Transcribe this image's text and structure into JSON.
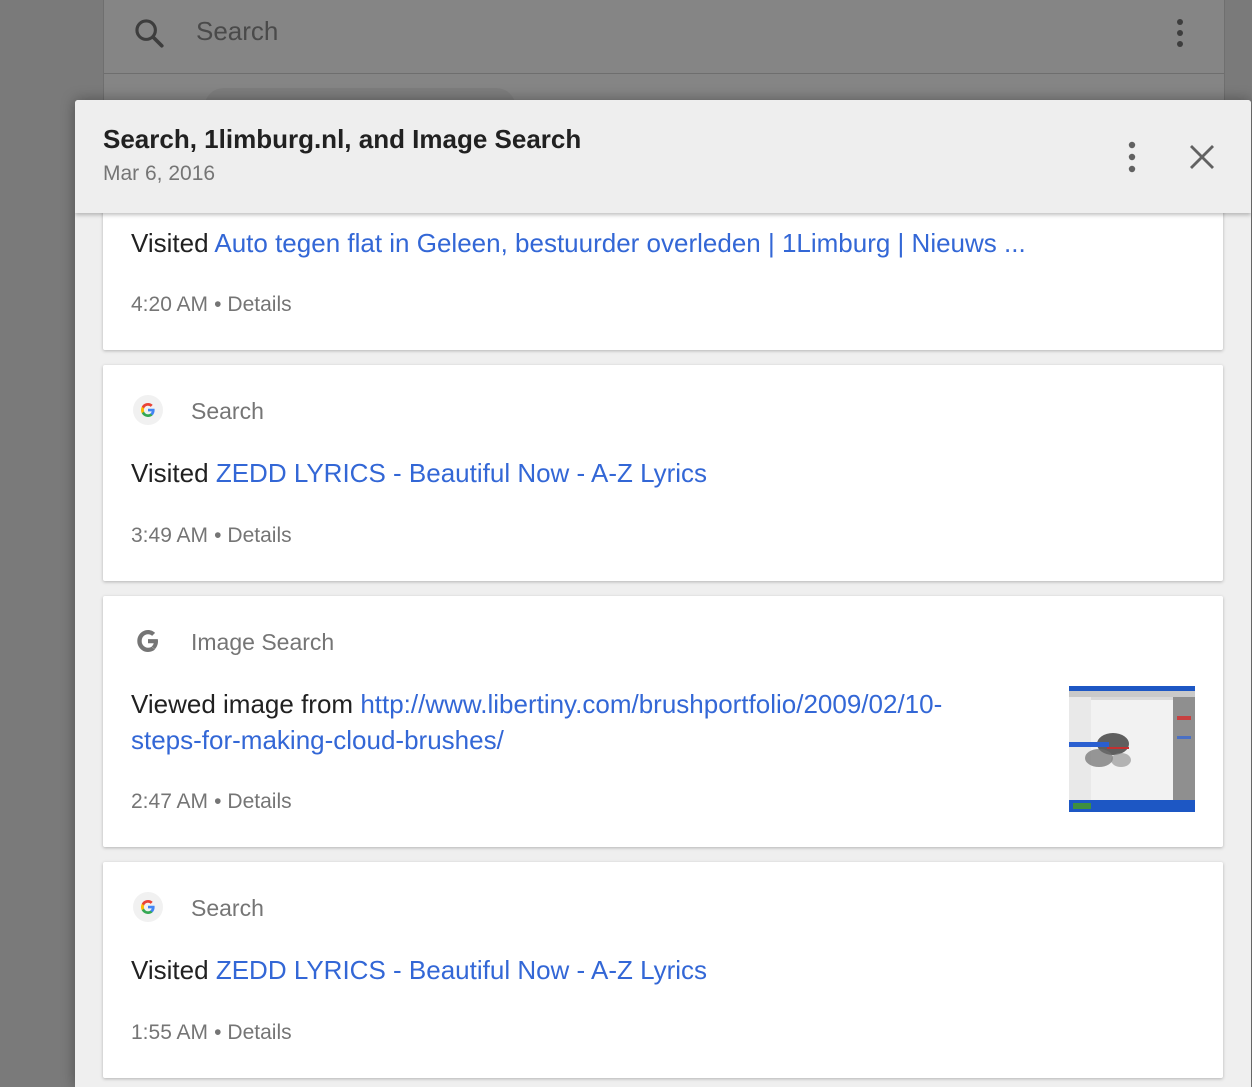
{
  "background": {
    "search_placeholder": "Search"
  },
  "dialog": {
    "title": "Search, 1limburg.nl, and Image Search",
    "date": "Mar 6, 2016"
  },
  "cards": [
    {
      "prefix": "Visited",
      "link": "Auto tegen flat in Geleen, bestuurder overleden | 1Limburg | Nieuws ...",
      "time": "4:20 AM",
      "details": "Details"
    },
    {
      "source": "Search",
      "source_icon": "google-color-icon",
      "prefix": "Visited",
      "link": "ZEDD LYRICS - Beautiful Now - A-Z Lyrics",
      "time": "3:49 AM",
      "details": "Details"
    },
    {
      "source": "Image Search",
      "source_icon": "google-gray-icon",
      "prefix": "Viewed image from",
      "link_line1": "http://www.libertiny.com/brushportfolio/2009/02/10-",
      "link_line2": "steps-for-making-cloud-brushes/",
      "time": "2:47 AM",
      "details": "Details"
    },
    {
      "source": "Search",
      "source_icon": "google-color-icon",
      "prefix": "Visited",
      "link": "ZEDD LYRICS - Beautiful Now - A-Z Lyrics",
      "time": "1:55 AM",
      "details": "Details"
    }
  ],
  "colors": {
    "link": "#3367d6",
    "overlay": "#7a7a7a",
    "meta": "#757575"
  }
}
